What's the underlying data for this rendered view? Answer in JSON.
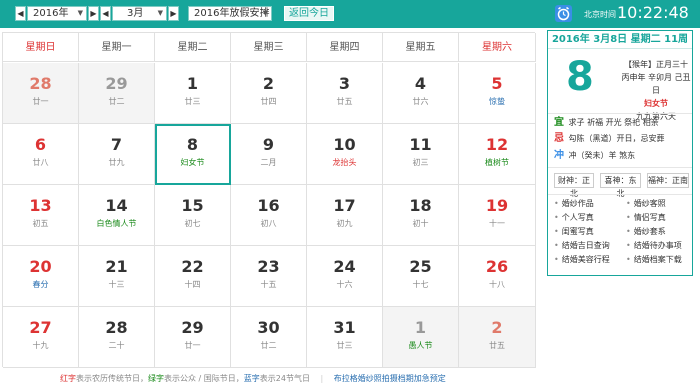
{
  "toolbar": {
    "year": "2016年",
    "month": "3月",
    "holiday_select": "2016年放假安排",
    "today_button": "返回今日",
    "prev": "◀",
    "next": "▶",
    "clock_label": "北京时间",
    "clock_time": "10:22:48"
  },
  "weekdays": [
    "星期日",
    "星期一",
    "星期二",
    "星期三",
    "星期四",
    "星期五",
    "星期六"
  ],
  "days": [
    {
      "n": "28",
      "sub": "廿一",
      "dim": true,
      "subType": ""
    },
    {
      "n": "29",
      "sub": "廿二",
      "dim": true,
      "subType": ""
    },
    {
      "n": "1",
      "sub": "廿三",
      "dim": false,
      "subType": ""
    },
    {
      "n": "2",
      "sub": "廿四",
      "dim": false,
      "subType": ""
    },
    {
      "n": "3",
      "sub": "廿五",
      "dim": false,
      "subType": ""
    },
    {
      "n": "4",
      "sub": "廿六",
      "dim": false,
      "subType": ""
    },
    {
      "n": "5",
      "sub": "惊蛰",
      "dim": false,
      "subType": "blue"
    },
    {
      "n": "6",
      "sub": "廿八",
      "dim": false,
      "subType": ""
    },
    {
      "n": "7",
      "sub": "廿九",
      "dim": false,
      "subType": ""
    },
    {
      "n": "8",
      "sub": "妇女节",
      "dim": false,
      "subType": "fest",
      "selected": true
    },
    {
      "n": "9",
      "sub": "二月",
      "dim": false,
      "subType": ""
    },
    {
      "n": "10",
      "sub": "龙抬头",
      "dim": false,
      "subType": "red"
    },
    {
      "n": "11",
      "sub": "初三",
      "dim": false,
      "subType": ""
    },
    {
      "n": "12",
      "sub": "植树节",
      "dim": false,
      "subType": "fest"
    },
    {
      "n": "13",
      "sub": "初五",
      "dim": false,
      "subType": ""
    },
    {
      "n": "14",
      "sub": "白色情人节",
      "dim": false,
      "subType": "fest"
    },
    {
      "n": "15",
      "sub": "初七",
      "dim": false,
      "subType": ""
    },
    {
      "n": "16",
      "sub": "初八",
      "dim": false,
      "subType": ""
    },
    {
      "n": "17",
      "sub": "初九",
      "dim": false,
      "subType": ""
    },
    {
      "n": "18",
      "sub": "初十",
      "dim": false,
      "subType": ""
    },
    {
      "n": "19",
      "sub": "十一",
      "dim": false,
      "subType": ""
    },
    {
      "n": "20",
      "sub": "春分",
      "dim": false,
      "subType": "blue"
    },
    {
      "n": "21",
      "sub": "十三",
      "dim": false,
      "subType": ""
    },
    {
      "n": "22",
      "sub": "十四",
      "dim": false,
      "subType": ""
    },
    {
      "n": "23",
      "sub": "十五",
      "dim": false,
      "subType": ""
    },
    {
      "n": "24",
      "sub": "十六",
      "dim": false,
      "subType": ""
    },
    {
      "n": "25",
      "sub": "十七",
      "dim": false,
      "subType": ""
    },
    {
      "n": "26",
      "sub": "十八",
      "dim": false,
      "subType": ""
    },
    {
      "n": "27",
      "sub": "十九",
      "dim": false,
      "subType": ""
    },
    {
      "n": "28",
      "sub": "二十",
      "dim": false,
      "subType": ""
    },
    {
      "n": "29",
      "sub": "廿一",
      "dim": false,
      "subType": ""
    },
    {
      "n": "30",
      "sub": "廿二",
      "dim": false,
      "subType": ""
    },
    {
      "n": "31",
      "sub": "廿三",
      "dim": false,
      "subType": ""
    },
    {
      "n": "1",
      "sub": "愚人节",
      "dim": true,
      "subType": "fest"
    },
    {
      "n": "2",
      "sub": "廿五",
      "dim": true,
      "subType": ""
    }
  ],
  "footer": {
    "red": "红字",
    "red_text": "表示农历传统节日，",
    "green": "绿字",
    "green_text": "表示公众 / 国际节日，",
    "blue": "蓝字",
    "blue_text": "表示24节气日",
    "divider": "|",
    "link": "布拉格婚纱照拍摄档期加急预定"
  },
  "panel": {
    "header": "2016年 3月8日 星期二 11周",
    "day": "8",
    "lunar_line1": "【猴年】正月三十",
    "lunar_line2": "丙申年 辛卯月 己丑日",
    "holiday": "妇女节",
    "lunar_line3": "九九第六天",
    "yi_tag": "宜",
    "yi_text": "求子  祈福  开光  祭祀  相亲",
    "ji_tag": "忌",
    "ji_text": "勾陈（黑道）开日，忌安葬",
    "chong_tag": "冲",
    "chong_text": "冲（癸未）羊  煞东",
    "gods": [
      "财神：正北",
      "喜神：东北",
      "福神：正南"
    ],
    "links": [
      "婚纱作品",
      "婚纱客照",
      "个人写真",
      "情侣写真",
      "闺蜜写真",
      "婚纱套系",
      "结婚吉日查询",
      "结婚待办事项",
      "结婚美容行程",
      "结婚档案下载"
    ]
  }
}
